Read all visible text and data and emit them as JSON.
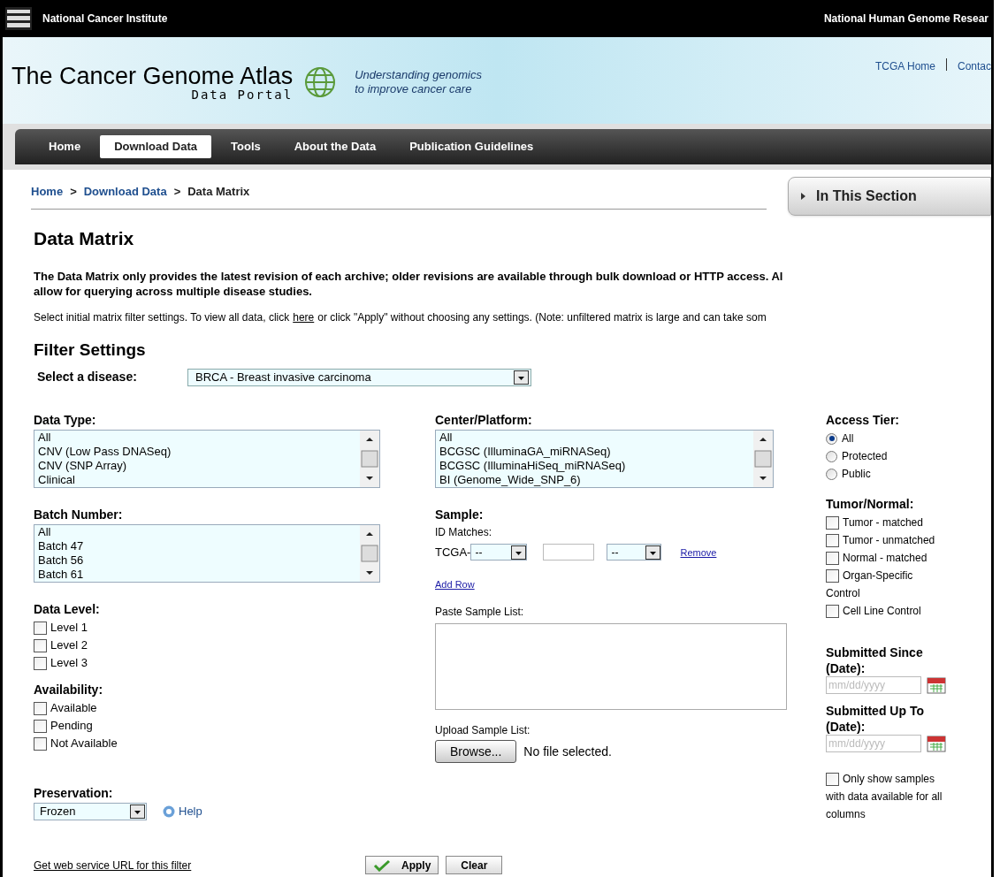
{
  "top_bar": {
    "left": "National Cancer Institute",
    "right": "National Human Genome Resear"
  },
  "header": {
    "title": "The Cancer Genome Atlas",
    "subtitle": "Data Portal",
    "tagline": [
      "Understanding genomics",
      "to improve cancer care"
    ],
    "links": [
      "TCGA Home",
      "Contac"
    ]
  },
  "nav": [
    {
      "label": "Home",
      "selected": false
    },
    {
      "label": "Download Data",
      "selected": true
    },
    {
      "label": "Tools",
      "selected": false
    },
    {
      "label": "About the Data",
      "selected": false
    },
    {
      "label": "Publication Guidelines",
      "selected": false
    }
  ],
  "breadcrumb": {
    "items": [
      "Home",
      "Download Data",
      "Data Matrix"
    ],
    "separator": ">"
  },
  "side_section": {
    "label": "In This Section"
  },
  "page_title": "Data Matrix",
  "intro_lines": [
    "The Data Matrix only provides the latest revision of each archive; older revisions are available through bulk download or HTTP access. Al",
    "allow for querying across multiple disease studies."
  ],
  "instruction": {
    "before": "Select initial matrix filter settings. To view all data, click",
    "link": "here",
    "after": "or click \"Apply\" without choosing any settings. (Note: unfiltered matrix is large and can take som"
  },
  "filter_title": "Filter Settings",
  "disease": {
    "label": "Select a disease:",
    "value": "BRCA - Breast invasive carcinoma"
  },
  "left_column": [
    {
      "kind": "listbox",
      "label": "Data Type:",
      "options": [
        "All",
        "CNV (Low Pass DNASeq)",
        "CNV (SNP Array)",
        "Clinical"
      ]
    },
    {
      "kind": "listbox",
      "label": "Batch Number:",
      "options": [
        "All",
        "Batch 47",
        "Batch 56",
        "Batch 61"
      ]
    },
    {
      "kind": "checkboxes",
      "label": "Data Level:",
      "items": [
        {
          "label": "Level 1",
          "checked": false
        },
        {
          "label": "Level 2",
          "checked": false
        },
        {
          "label": "Level 3",
          "checked": false
        }
      ]
    },
    {
      "kind": "checkboxes",
      "label": "Availability:",
      "items": [
        {
          "label": "Available",
          "checked": false
        },
        {
          "label": "Pending",
          "checked": false
        },
        {
          "label": "Not Available",
          "checked": false
        }
      ]
    },
    {
      "kind": "dropdown",
      "label": "Preservation:",
      "value": "Frozen",
      "help": "Help"
    }
  ],
  "center_platform": {
    "label": "Center/Platform:",
    "options": [
      "All",
      "BCGSC (IlluminaGA_miRNASeq)",
      "BCGSC (IlluminaHiSeq_miRNASeq)",
      "BI (Genome_Wide_SNP_6)"
    ]
  },
  "sample": {
    "label": "Sample:",
    "id_label": "ID Matches:",
    "prefix": "TCGA-",
    "select_1": "--",
    "select_2": "--",
    "remove": "Remove",
    "add_row": "Add Row"
  },
  "paste": {
    "label": "Paste Sample List:"
  },
  "upload": {
    "label": "Upload Sample List:",
    "button": "Browse...",
    "status": "No file selected."
  },
  "access_tier": {
    "label": "Access Tier:",
    "options": [
      {
        "label": "All",
        "selected": true
      },
      {
        "label": "Protected",
        "selected": false
      },
      {
        "label": "Public",
        "selected": false
      }
    ]
  },
  "tumor_normal": {
    "label": "Tumor/Normal:",
    "items": [
      {
        "lines": [
          "Tumor - matched"
        ],
        "checked": false
      },
      {
        "lines": [
          "Tumor - unmatched"
        ],
        "checked": false
      },
      {
        "lines": [
          "Normal - matched"
        ],
        "checked": false
      },
      {
        "lines": [
          "Organ-Specific",
          "Control"
        ],
        "checked": false
      },
      {
        "lines": [
          "Cell Line Control"
        ],
        "checked": false
      }
    ]
  },
  "dates": [
    {
      "label": "Submitted Since (Date):",
      "placeholder": "mm/dd/yyyy"
    },
    {
      "label": "Submitted Up To (Date):",
      "placeholder": "mm/dd/yyyy"
    }
  ],
  "only_show": {
    "lines": [
      "Only show samples",
      "with data available for all",
      "columns"
    ],
    "checked": false
  },
  "footer": {
    "link": "Get web service URL for this filter",
    "apply": "Apply",
    "clear": "Clear"
  }
}
